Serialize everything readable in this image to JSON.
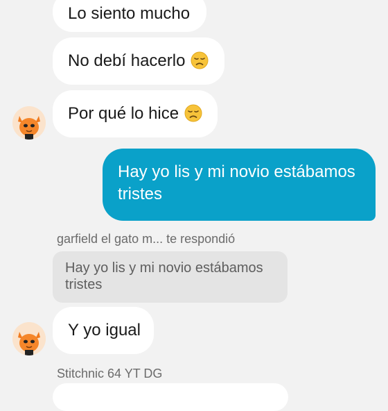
{
  "messages": {
    "m1": {
      "text": "Lo siento mucho"
    },
    "m2": {
      "text": "No debí hacerlo",
      "emoji": "disappointed-face"
    },
    "m3": {
      "text": "Por qué lo hice",
      "emoji": "disappointed-face"
    },
    "m4": {
      "text": "Hay yo lis y mi novio estábamos tristes"
    },
    "reply": {
      "meta": "garfield el gato m... te respondió",
      "quoted": "Hay yo lis y mi novio estábamos tristes",
      "text": "Y yo igual"
    },
    "next_sender": "Stitchnic 64 YT DG"
  },
  "colors": {
    "outgoing_bubble": "#0aa1c9",
    "incoming_bubble": "#ffffff",
    "background": "#f2f2f2",
    "quoted_bg": "#e4e4e4"
  },
  "icons": {
    "avatar": "orange-cat-avatar",
    "emoji": "disappointed-face"
  }
}
